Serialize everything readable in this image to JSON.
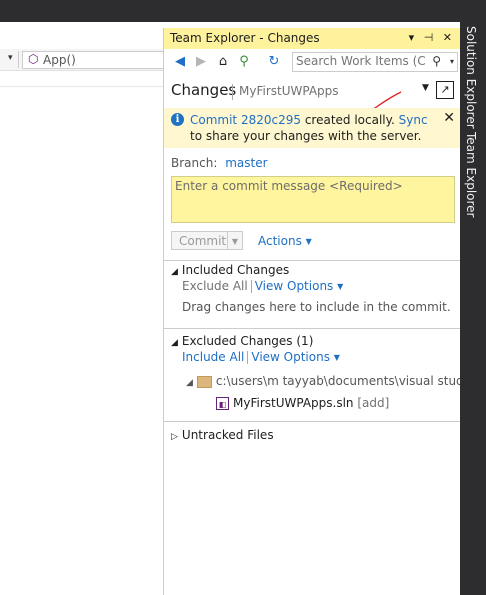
{
  "editor": {
    "app_dropdown_label": "App()"
  },
  "team_explorer": {
    "title": "Team Explorer - Changes",
    "title_buttons": "▾ ⊣ ✕",
    "search_placeholder": "Search Work Items (Ctrl+",
    "page_title": "Changes",
    "repo_name": "MyFirstUWPApps",
    "notice": {
      "commit_link": "Commit 2820c295",
      "text_mid": " created locally. ",
      "sync_link": "Sync",
      "text_end": " to share your changes with the server."
    },
    "branch_label": "Branch:",
    "branch_name": "master",
    "commit_placeholder": "Enter a commit message <Required>",
    "commit_button": "Commit",
    "actions_link": "Actions",
    "included": {
      "title": "Included Changes",
      "exclude_all": "Exclude All",
      "view_options": "View Options",
      "drag_text": "Drag changes here to include in the commit."
    },
    "excluded": {
      "title": "Excluded Changes (1)",
      "include_all": "Include All",
      "view_options": "View Options",
      "folder_path": "c:\\users\\m tayyab\\documents\\visual studi...",
      "file_name": "MyFirstUWPApps.sln",
      "file_tag": "[add]"
    },
    "untracked": {
      "title": "Untracked Files"
    }
  },
  "side_tabs": {
    "solution_explorer": "Solution Explorer",
    "team_explorer": "Team Explorer"
  },
  "colors": {
    "title_bar": "#fff29d",
    "link": "#1e6fc5",
    "notice_bg": "#fff7d0",
    "commit_box": "#fff59e",
    "dark_chrome": "#2d2d30"
  }
}
